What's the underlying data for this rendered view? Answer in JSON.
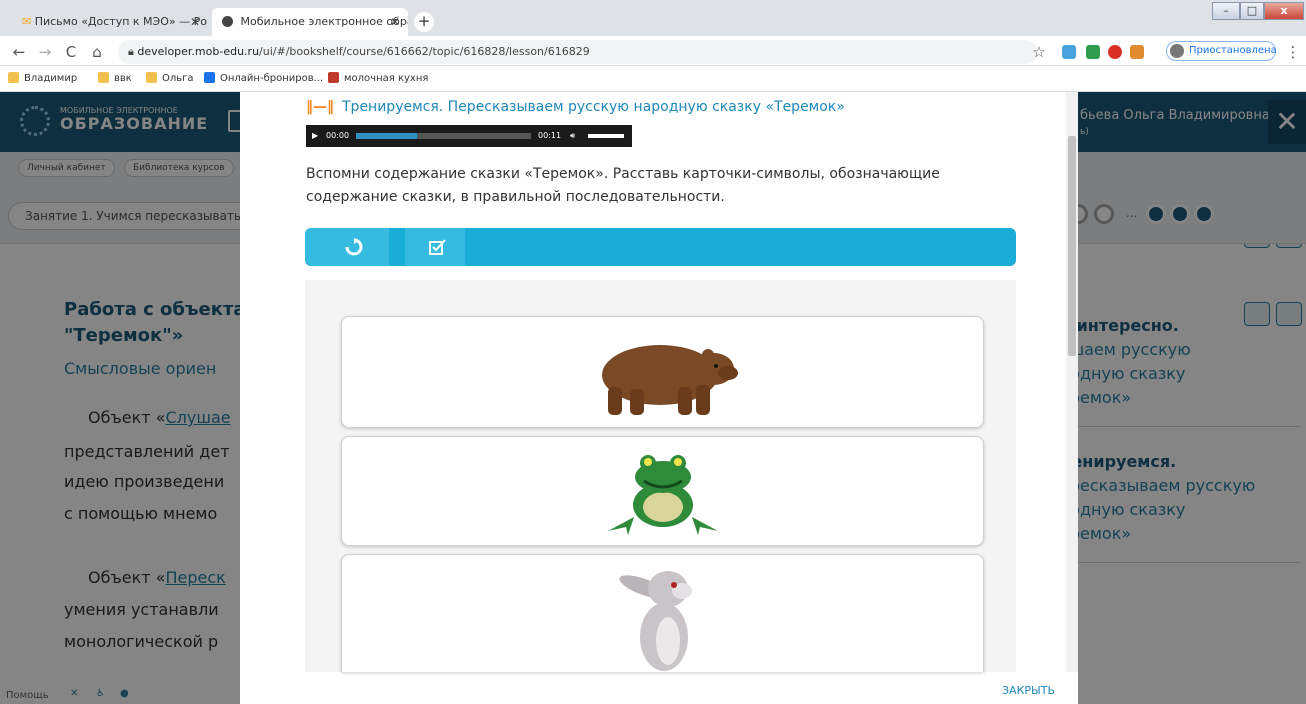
{
  "browser": {
    "tabs": [
      {
        "title": "Письмо «Доступ к МЭО» — Ро",
        "active": false
      },
      {
        "title": "Мобильное электронное обра:",
        "active": true
      }
    ],
    "url_domain": "developer.mob-edu.ru",
    "url_path": "/ui/#/bookshelf/course/616662/topic/616828/lesson/616829",
    "profile_status": "Приостановлена",
    "bookmarks": [
      "Владимир",
      "ввк",
      "Ольга",
      "Онлайн-брониров...",
      "молочная кухня"
    ]
  },
  "site": {
    "logo_small": "МОБИЛЬНОЕ ЭЛЕКТРОННОЕ",
    "logo_big": "ОБРАЗОВАНИЕ",
    "user_name": "бьева Ольга Владимировна",
    "user_sub": "ь)",
    "breadcrumbs": [
      "Личный кабинет",
      "Библиотека курсов"
    ],
    "lesson_title": "Занятие 1. Учимся пересказывать с",
    "pager_dots": "...",
    "content": {
      "heading1": "Работа с объекта",
      "heading2": "\"Теремок\"»",
      "subheading": "Смысловые ориен",
      "p1_pre": "Объект «",
      "p1_link": "Слушае",
      "p1_lines": [
        "представлений дет",
        "идею произведени",
        "с помощью мнемо"
      ],
      "p2_pre": "Объект «",
      "p2_link": "Переск",
      "p2_lines": [
        "умения устанавли",
        "монологической р"
      ]
    },
    "right_nav": [
      {
        "text": "о интересно.",
        "bold": true
      },
      {
        "text": "ушаем русскую",
        "bold": false
      },
      {
        "text": "родную сказку",
        "bold": false
      },
      {
        "text": "еремок»",
        "bold": false
      },
      {
        "text": "ренируемся.",
        "bold": true
      },
      {
        "text": "ересказываем русскую",
        "bold": false
      },
      {
        "text": "родную сказку",
        "bold": false
      },
      {
        "text": "еремок»",
        "bold": false
      }
    ],
    "footer_help": "Помощь"
  },
  "modal": {
    "title": "Тренируемся. Пересказываем русскую народную сказку «Теремок»",
    "player": {
      "current": "00:00",
      "duration": "00:11",
      "progress": 0.35
    },
    "task": "Вспомни содержание сказки «Теремок». Расставь карточки-символы, обозначающие содержание сказки, в правильной последовательности.",
    "cards": [
      "bear-card",
      "frog-card",
      "hare-card"
    ],
    "close_label": "ЗАКРЫТЬ"
  }
}
